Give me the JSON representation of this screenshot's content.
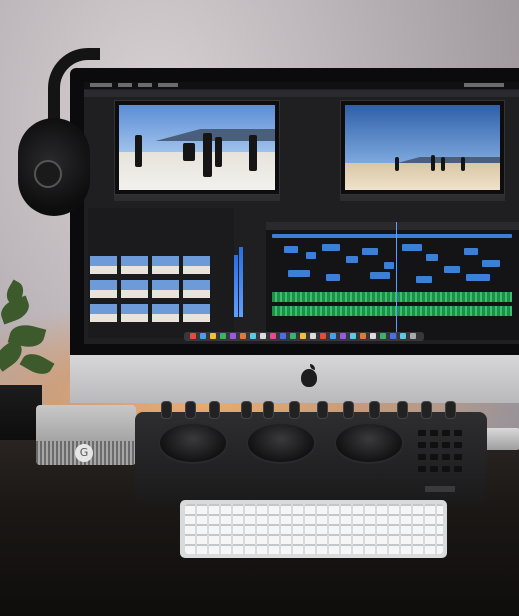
{
  "scene": {
    "subject": "",
    "colors": {
      "wall": "#b9b2b6",
      "glow": "#e88c3c",
      "desk": "#1b1816",
      "timeline_clip": "#3c7fd6",
      "audio_track": "#39c06a"
    }
  },
  "objects": {
    "headphones_icon": "headphones-icon",
    "monitor_icon": "monitor-icon",
    "apple_logo_icon": "apple-logo-icon",
    "plant_icon": "plant-icon",
    "drive_icon": "hard-drive-icon",
    "control_surface_icon": "color-panel-icon",
    "keyboard_icon": "keyboard-icon",
    "hub_icon": "usb-hub-icon"
  },
  "drive": {
    "logo": "G"
  }
}
